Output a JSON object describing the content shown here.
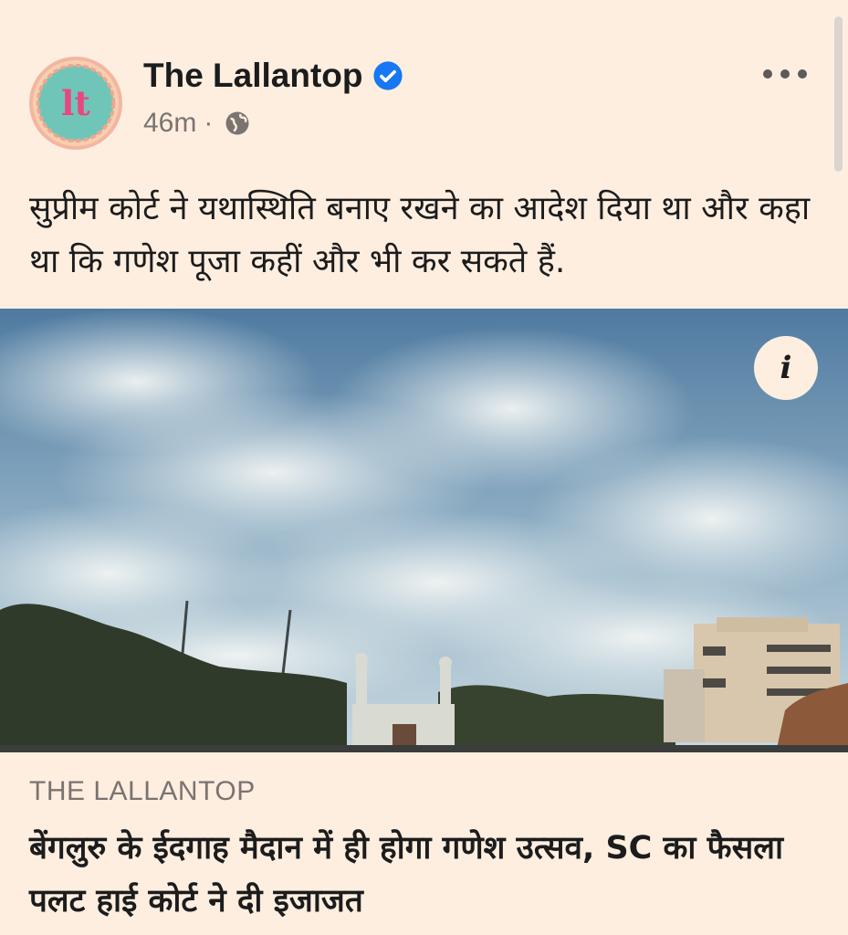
{
  "post": {
    "page_name": "The Lallantop",
    "time": "46m",
    "separator": "·",
    "caption": "सुप्रीम कोर्ट ने यथास्थिति बनाए रखने का आदेश दिया था और कहा था कि गणेश पूजा कहीं और भी कर सकते हैं.",
    "audience_icon": "globe-icon",
    "verified_icon": "verified-badge-icon",
    "avatar_letters": "lt"
  },
  "link_preview": {
    "source": "THE LALLANTOP",
    "headline": "बेंगलुरु के ईदगाह मैदान में ही होगा गणेश उत्सव, SC का फैसला पलट हाई कोर्ट ने दी इजाजत",
    "info_label": "i"
  },
  "colors": {
    "background": "#fdeee0",
    "text": "#1c1c1c",
    "muted": "#7b7370",
    "verified": "#1877f2"
  }
}
